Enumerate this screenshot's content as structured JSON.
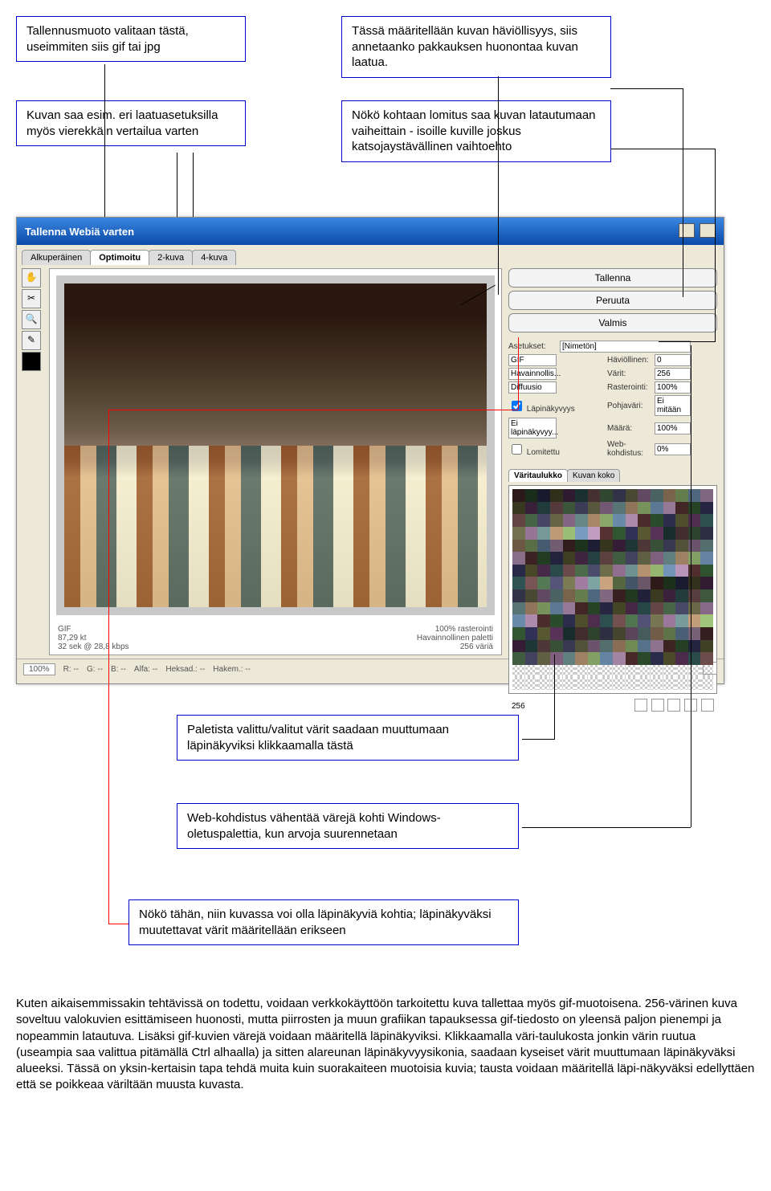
{
  "annotations": {
    "a1": "Tallennusmuoto valitaan tästä, useimmiten siis gif tai jpg",
    "a2": "Kuvan saa esim. eri laatuasetuksilla myös vierekkäin vertailua varten",
    "a3": "Tässä määritellään kuvan häviöllisyys, siis annetaanko pakkauksen huonontaa kuvan laatua.",
    "a4": "Nökö kohtaan lomitus saa kuvan latautumaan vaiheittain - isoille kuville joskus katsojaystävällinen vaihtoehto",
    "a5": "Paletista valittu/valitut värit saadaan muuttumaan läpinäkyviksi klikkaamalla tästä",
    "a6": "Web-kohdistus vähentää värejä kohti Windows-oletuspalettia, kun arvoja suurennetaan",
    "a7": "Nökö tähän, niin kuvassa voi olla läpinäkyviä kohtia; läpinäkyväksi muutettavat värit määritellään erikseen"
  },
  "window": {
    "title": "Tallenna Webiä varten",
    "tabs": [
      "Alkuperäinen",
      "Optimoitu",
      "2-kuva",
      "4-kuva"
    ],
    "buttons": {
      "save": "Tallenna",
      "cancel": "Peruuta",
      "done": "Valmis"
    },
    "settings": {
      "preset_label": "Asetukset:",
      "preset_value": "[Nimetön]",
      "format": "GIF",
      "lossy_label": "Häviöllinen:",
      "lossy_value": "0",
      "reduction": "Havainnollis...",
      "colors_label": "Värit:",
      "colors_value": "256",
      "dither": "Diffuusio",
      "dither_pct_label": "Rasterointi:",
      "dither_pct_value": "100%",
      "transparency": "Läpinäkyvyys",
      "matte_label": "Pohjaväri:",
      "matte_value": "Ei mitään",
      "no_trans_dither": "Ei läpinäkyvyy...",
      "amount_label": "Määrä:",
      "amount_value": "100%",
      "interlaced": "Lomitettu",
      "websnap_label": "Web-kohdistus:",
      "websnap_value": "0%"
    },
    "palette_tabs": [
      "Väritaulukko",
      "Kuvan koko"
    ],
    "palette_count": "256",
    "preview_info": {
      "format": "GIF",
      "size": "87,29 kt",
      "time": "32 sek @ 28,8 kbps",
      "dither": "100% rasterointi",
      "algo": "Havainnollinen paletti",
      "colors": "256 väriä"
    },
    "status": {
      "zoom": "100%",
      "r": "R:  --",
      "g": "G:  --",
      "b": "B:  --",
      "alpha": "Alfa:  --",
      "hex": "Heksad.:  --",
      "index": "Hakem.:  --"
    }
  },
  "body_text": "Kuten aikaisemmissakin tehtävissä on todettu, voidaan verkkokäyttöön tarkoitettu kuva tallettaa myös gif-muotoisena. 256-värinen kuva soveltuu valokuvien esittämiseen huonosti, mutta piirrosten ja muun grafiikan tapauksessa gif-tiedosto on yleensä paljon pienempi ja nopeammin latautuva. Lisäksi gif-kuvien värejä voidaan määritellä läpinäkyviksi. Klikkaamalla väri-taulukosta jonkin värin ruutua (useampia saa valittua pitämällä Ctrl alhaalla) ja sitten alareunan läpinäkyvyysikonia, saadaan kyseiset värit muuttumaan läpinäkyväksi alueeksi. Tässä on yksin-kertaisin tapa tehdä muita kuin suorakaiteen muotoisia kuvia; tausta voidaan määritellä läpi-näkyväksi edellyttäen että se poikkeaa väriltään muusta kuvasta."
}
